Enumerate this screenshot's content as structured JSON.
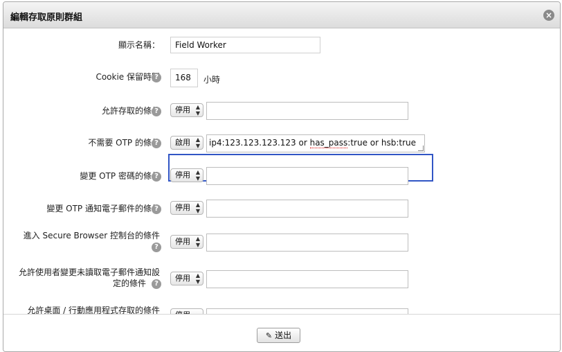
{
  "dialog": {
    "title": "編輯存取原則群組",
    "close_icon": "close-icon"
  },
  "form": {
    "display_name": {
      "label": "顯示名稱：",
      "value": "Field Worker"
    },
    "cookie": {
      "label": "Cookie 保留時間",
      "value": "168",
      "unit": "小時"
    },
    "rows": [
      {
        "label": "允許存取的條件",
        "state": "停用",
        "value": ""
      },
      {
        "label": "不需要 OTP 的條件",
        "state": "啟用",
        "value_before": "ip4:123.123.123.123 or ",
        "value_flag": "has_pass",
        "value_after": ":true or hsb:true"
      },
      {
        "label": "變更 OTP 密碼的條件",
        "state": "停用",
        "value": ""
      },
      {
        "label": "變更 OTP 通知電子郵件的條件",
        "state": "停用",
        "value": ""
      },
      {
        "label": "進入 Secure Browser 控制台的條件",
        "state": "停用",
        "value": ""
      },
      {
        "label_line1": "允許使用者變更未讀取電子郵件通知設",
        "label_line2": "定的條件",
        "state": "停用",
        "value": ""
      },
      {
        "label": "允許桌面 / 行動應用程式存取的條件",
        "state": "停用",
        "value": ""
      }
    ]
  },
  "footer": {
    "submit_label": "送出"
  }
}
